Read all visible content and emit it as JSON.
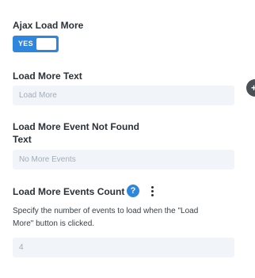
{
  "ajax": {
    "label": "Ajax Load More",
    "toggle_text": "YES"
  },
  "load_more_text": {
    "label": "Load More Text",
    "placeholder": "Load More"
  },
  "not_found": {
    "label_line1": "Load More Event Not Found",
    "label_line2": "Text",
    "placeholder": "No More Events"
  },
  "events_count": {
    "label": "Load More Events Count",
    "help_glyph": "?",
    "description_line1": "Specify the number of events to load when the \"Load",
    "description_line2": "More\" button is clicked.",
    "value": "4"
  },
  "side_button": {
    "glyph": "+"
  },
  "colors": {
    "accent": "#2f86dd",
    "field_bg": "#f1f4f8",
    "placeholder": "#a4adb8",
    "label": "#2b3137"
  },
  "icons": [
    "help-icon",
    "more-options-icon",
    "side-add-icon"
  ]
}
